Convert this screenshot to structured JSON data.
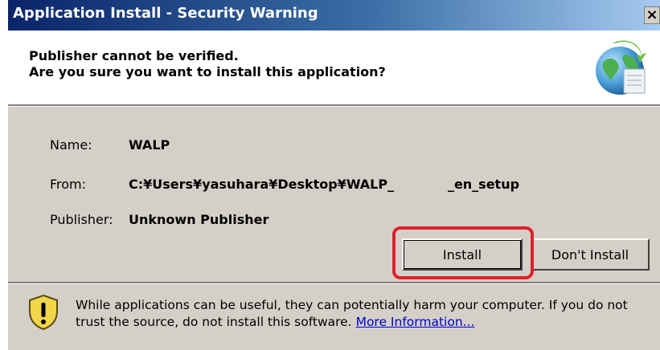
{
  "window": {
    "title": "Application Install - Security Warning",
    "close_glyph": "×"
  },
  "header": {
    "line1": "Publisher cannot be verified.",
    "line2": "Are you sure you want to install this application?",
    "icon": "globe-install-icon"
  },
  "details": {
    "name_label": "Name:",
    "name_value": "WALP",
    "from_label": "From:",
    "from_value": "C:¥Users¥yasuhara¥Desktop¥WALP_            _en_setup",
    "publisher_label": "Publisher:",
    "publisher_value": "Unknown Publisher"
  },
  "buttons": {
    "install": "Install",
    "dont_install": "Don't Install"
  },
  "footer": {
    "warning_text": "While applications can be useful, they can potentially harm your computer. If you do not trust the source, do not install this software.",
    "more_info": "More Information..."
  },
  "colors": {
    "highlight": "#e0202a",
    "dialog_bg": "#d4d0c8",
    "title_bar": "#0a246a",
    "link": "#0000cc"
  }
}
